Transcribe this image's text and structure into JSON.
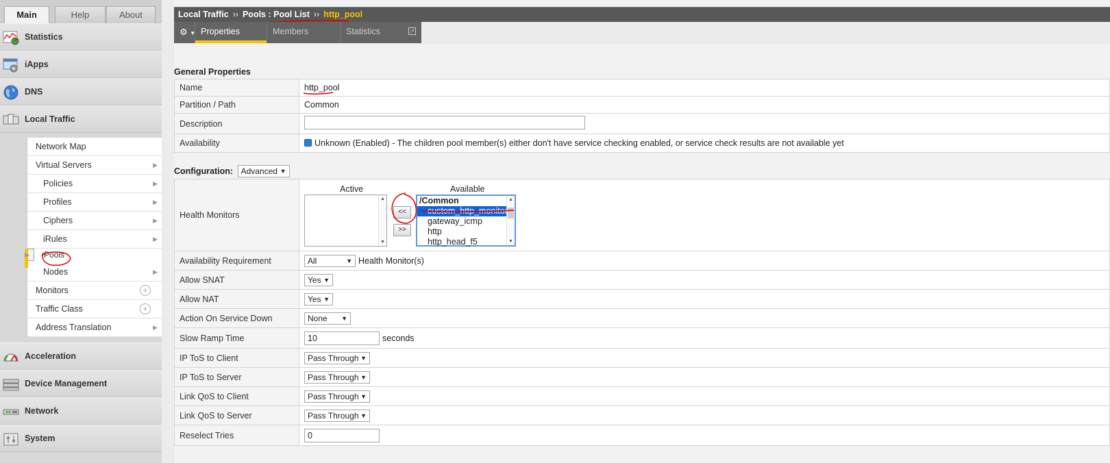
{
  "nav": {
    "tabs": [
      "Main",
      "Help",
      "About"
    ],
    "categories_top": [
      "Statistics",
      "iApps",
      "DNS",
      "Local Traffic"
    ],
    "local_traffic_items": [
      {
        "label": "Network Map",
        "indent": false,
        "type": "none"
      },
      {
        "label": "Virtual Servers",
        "indent": false,
        "type": "arrow"
      },
      {
        "label": "Policies",
        "indent": true,
        "type": "arrow"
      },
      {
        "label": "Profiles",
        "indent": true,
        "type": "arrow"
      },
      {
        "label": "Ciphers",
        "indent": true,
        "type": "arrow"
      },
      {
        "label": "iRules",
        "indent": true,
        "type": "arrow"
      },
      {
        "label": "Pools",
        "indent": true,
        "type": "arrow",
        "selected": true
      },
      {
        "label": "Nodes",
        "indent": true,
        "type": "arrow"
      },
      {
        "label": "Monitors",
        "indent": false,
        "type": "plus"
      },
      {
        "label": "Traffic Class",
        "indent": false,
        "type": "plus"
      },
      {
        "label": "Address Translation",
        "indent": false,
        "type": "arrow"
      }
    ],
    "categories_bottom": [
      "Acceleration",
      "Device Management",
      "Network",
      "System"
    ]
  },
  "breadcrumb": {
    "part1": "Local Traffic",
    "sep": "››",
    "part2": "Pools : Pool List",
    "current": "http_pool"
  },
  "tabs": [
    "Properties",
    "Members",
    "Statistics"
  ],
  "general": {
    "title": "General Properties",
    "name_label": "Name",
    "name_value": "http_pool",
    "partition_label": "Partition / Path",
    "partition_value": "Common",
    "description_label": "Description",
    "description_value": "",
    "availability_label": "Availability",
    "availability_value": "Unknown (Enabled) - The children pool member(s) either don't have service checking enabled, or service check results are not available yet"
  },
  "config": {
    "title": "Configuration:",
    "mode": "Advanced",
    "health_monitors_label": "Health Monitors",
    "active_header": "Active",
    "available_header": "Available",
    "available_group": "/Common",
    "available_items": [
      "custom_http_monitor",
      "gateway_icmp",
      "http",
      "http_head_f5"
    ],
    "selected_item": "custom_http_monitor",
    "btn_add": "<<",
    "btn_remove": ">>",
    "rows": [
      {
        "label": "Availability Requirement",
        "select": "All",
        "suffix": "Health Monitor(s)"
      },
      {
        "label": "Allow SNAT",
        "select": "Yes"
      },
      {
        "label": "Allow NAT",
        "select": "Yes"
      },
      {
        "label": "Action On Service Down",
        "select": "None"
      },
      {
        "label": "Slow Ramp Time",
        "input": "10",
        "suffix": "seconds"
      },
      {
        "label": "IP ToS to Client",
        "select": "Pass Through"
      },
      {
        "label": "IP ToS to Server",
        "select": "Pass Through"
      },
      {
        "label": "Link QoS to Client",
        "select": "Pass Through"
      },
      {
        "label": "Link QoS to Server",
        "select": "Pass Through"
      },
      {
        "label": "Reselect Tries",
        "input": "0"
      }
    ]
  },
  "colors": {
    "accent": "#f5c400",
    "annotation": "#e00000",
    "selection": "#0a64d8"
  }
}
